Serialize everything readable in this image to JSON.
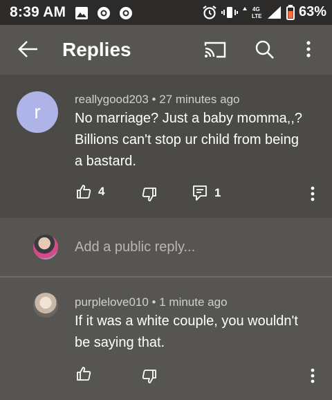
{
  "status_bar": {
    "time": "8:39 AM",
    "network": "4G LTE",
    "battery": "63%"
  },
  "app_bar": {
    "title": "Replies"
  },
  "parent_comment": {
    "avatar_letter": "r",
    "avatar_color": "#aeb3e8",
    "author": "reallygood203",
    "time": "27 minutes ago",
    "text_lines": [
      "No marriage?  Just a baby momma,,?",
      "Billions can't stop ur child from being",
      "a bastard."
    ],
    "likes": "4",
    "replies": "1"
  },
  "reply_input": {
    "placeholder": "Add a public reply..."
  },
  "replies": [
    {
      "author": "purplelove010",
      "time": "1 minute ago",
      "text_lines": [
        "If it was a white couple, you wouldn't",
        "be saying that."
      ]
    }
  ],
  "colors": {
    "background": "#575551",
    "highlight_background": "#4b4a46",
    "status_bar": "#2c2b29"
  }
}
